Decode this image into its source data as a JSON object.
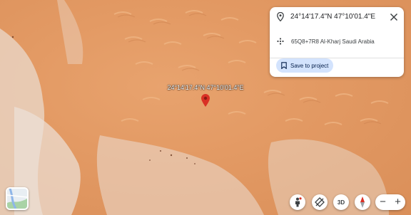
{
  "map": {
    "pin_label": "24°14'17.4\"N 47°10'01.4\"E"
  },
  "info_card": {
    "coordinates": "24°14'17.4\"N 47°10'01.4\"E",
    "plus_code": "65Q8+7R8 Al-Kharj Saudi Arabia",
    "save_label": "Save to project"
  },
  "controls": {
    "three_d_label": "3D",
    "zoom_in_label": "+",
    "zoom_out_label": "−"
  },
  "colors": {
    "pin": "#d93025",
    "save_button_bg": "#d3e3fd",
    "sand": "#e39a64"
  },
  "icons": [
    "location-pin-icon",
    "plus-code-icon",
    "close-icon",
    "save-icon",
    "pegman-icon",
    "tilt-icon",
    "compass-icon"
  ]
}
